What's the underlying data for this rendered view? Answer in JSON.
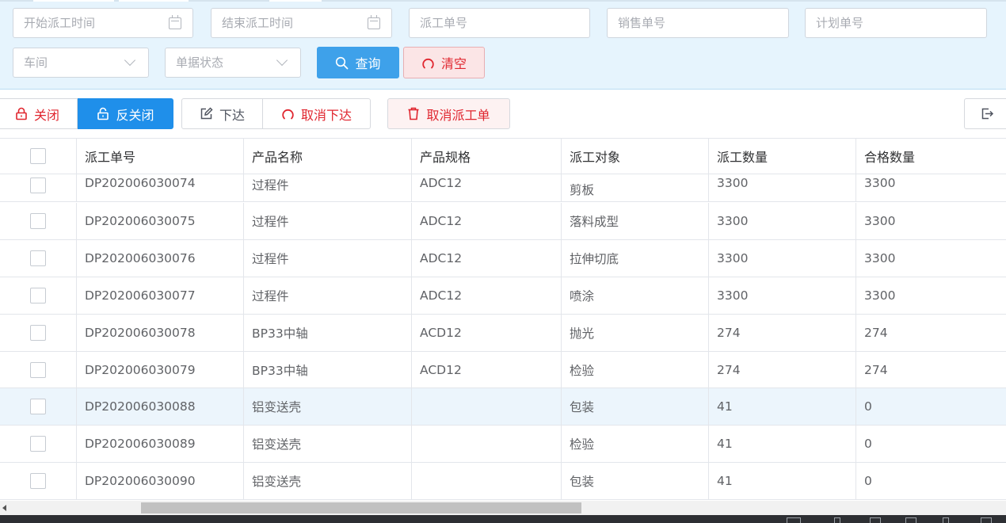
{
  "filters": {
    "start_time_placeholder": "开始派工时间",
    "end_time_placeholder": "结束派工时间",
    "dispatch_no_placeholder": "派工单号",
    "sales_no_placeholder": "销售单号",
    "plan_no_placeholder": "计划单号",
    "workshop_placeholder": "车间",
    "status_placeholder": "单据状态",
    "query_label": "查询",
    "clear_label": "清空"
  },
  "toolbar": {
    "close_label": "关闭",
    "reopen_label": "反关闭",
    "issue_label": "下达",
    "cancel_issue_label": "取消下达",
    "cancel_order_label": "取消派工单"
  },
  "table": {
    "columns": [
      "派工单号",
      "产品名称",
      "产品规格",
      "派工对象",
      "派工数量",
      "合格数量"
    ],
    "rows": [
      {
        "no": "DP202006030074",
        "product": "过程件",
        "spec": "ADC12",
        "target": "剪板",
        "qty": "3300",
        "qualified": "3300"
      },
      {
        "no": "DP202006030075",
        "product": "过程件",
        "spec": "ADC12",
        "target": "落料成型",
        "qty": "3300",
        "qualified": "3300"
      },
      {
        "no": "DP202006030076",
        "product": "过程件",
        "spec": "ADC12",
        "target": "拉伸切底",
        "qty": "3300",
        "qualified": "3300"
      },
      {
        "no": "DP202006030077",
        "product": "过程件",
        "spec": "ADC12",
        "target": "喷涂",
        "qty": "3300",
        "qualified": "3300"
      },
      {
        "no": "DP202006030078",
        "product": "BP33中轴",
        "spec": "ACD12",
        "target": "抛光",
        "qty": "274",
        "qualified": "274"
      },
      {
        "no": "DP202006030079",
        "product": "BP33中轴",
        "spec": "ACD12",
        "target": "检验",
        "qty": "274",
        "qualified": "274"
      },
      {
        "no": "DP202006030088",
        "product": "铝变送壳",
        "spec": "",
        "target": "包装",
        "qty": "41",
        "qualified": "0"
      },
      {
        "no": "DP202006030089",
        "product": "铝变送壳",
        "spec": "",
        "target": "检验",
        "qty": "41",
        "qualified": "0"
      },
      {
        "no": "DP202006030090",
        "product": "铝变送壳",
        "spec": "",
        "target": "包装",
        "qty": "41",
        "qualified": "0"
      }
    ]
  },
  "colors": {
    "panel_bg": "#e6f4fd",
    "primary": "#1f8fea",
    "query_bg": "#3ea1ea",
    "danger": "#e0262f",
    "highlight_row": "#ecf5fc"
  },
  "icons": {
    "calendar": "calendar-icon",
    "dropdown": "chevron-down-icon",
    "search": "search-icon",
    "refresh": "refresh-icon",
    "lock": "lock-icon",
    "unlock": "unlock-icon",
    "edit": "edit-icon",
    "trash": "trash-icon",
    "export": "export-icon"
  }
}
